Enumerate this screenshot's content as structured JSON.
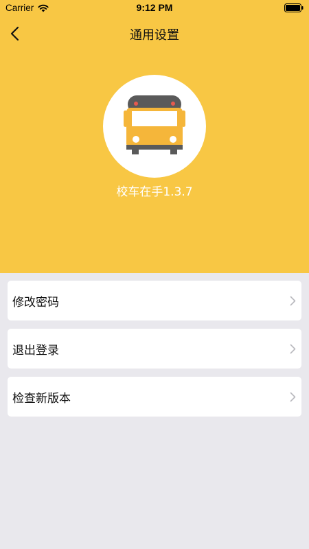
{
  "status_bar": {
    "carrier": "Carrier",
    "time": "9:12 PM"
  },
  "nav": {
    "title": "通用设置",
    "back_icon": "chevron-left-icon"
  },
  "app": {
    "logo_icon": "school-bus-icon",
    "version_text": "校车在手1.3.7"
  },
  "menu": {
    "items": [
      {
        "label": "修改密码",
        "icon": "chevron-right-icon"
      },
      {
        "label": "退出登录",
        "icon": "chevron-right-icon"
      },
      {
        "label": "检查新版本",
        "icon": "chevron-right-icon"
      }
    ]
  },
  "colors": {
    "header_bg": "#f8c744",
    "page_bg": "#e9e8ed",
    "card_bg": "#ffffff",
    "bus_body": "#f5b63a",
    "bus_dark": "#5a5a5a",
    "bus_light_red": "#e75b4e"
  }
}
